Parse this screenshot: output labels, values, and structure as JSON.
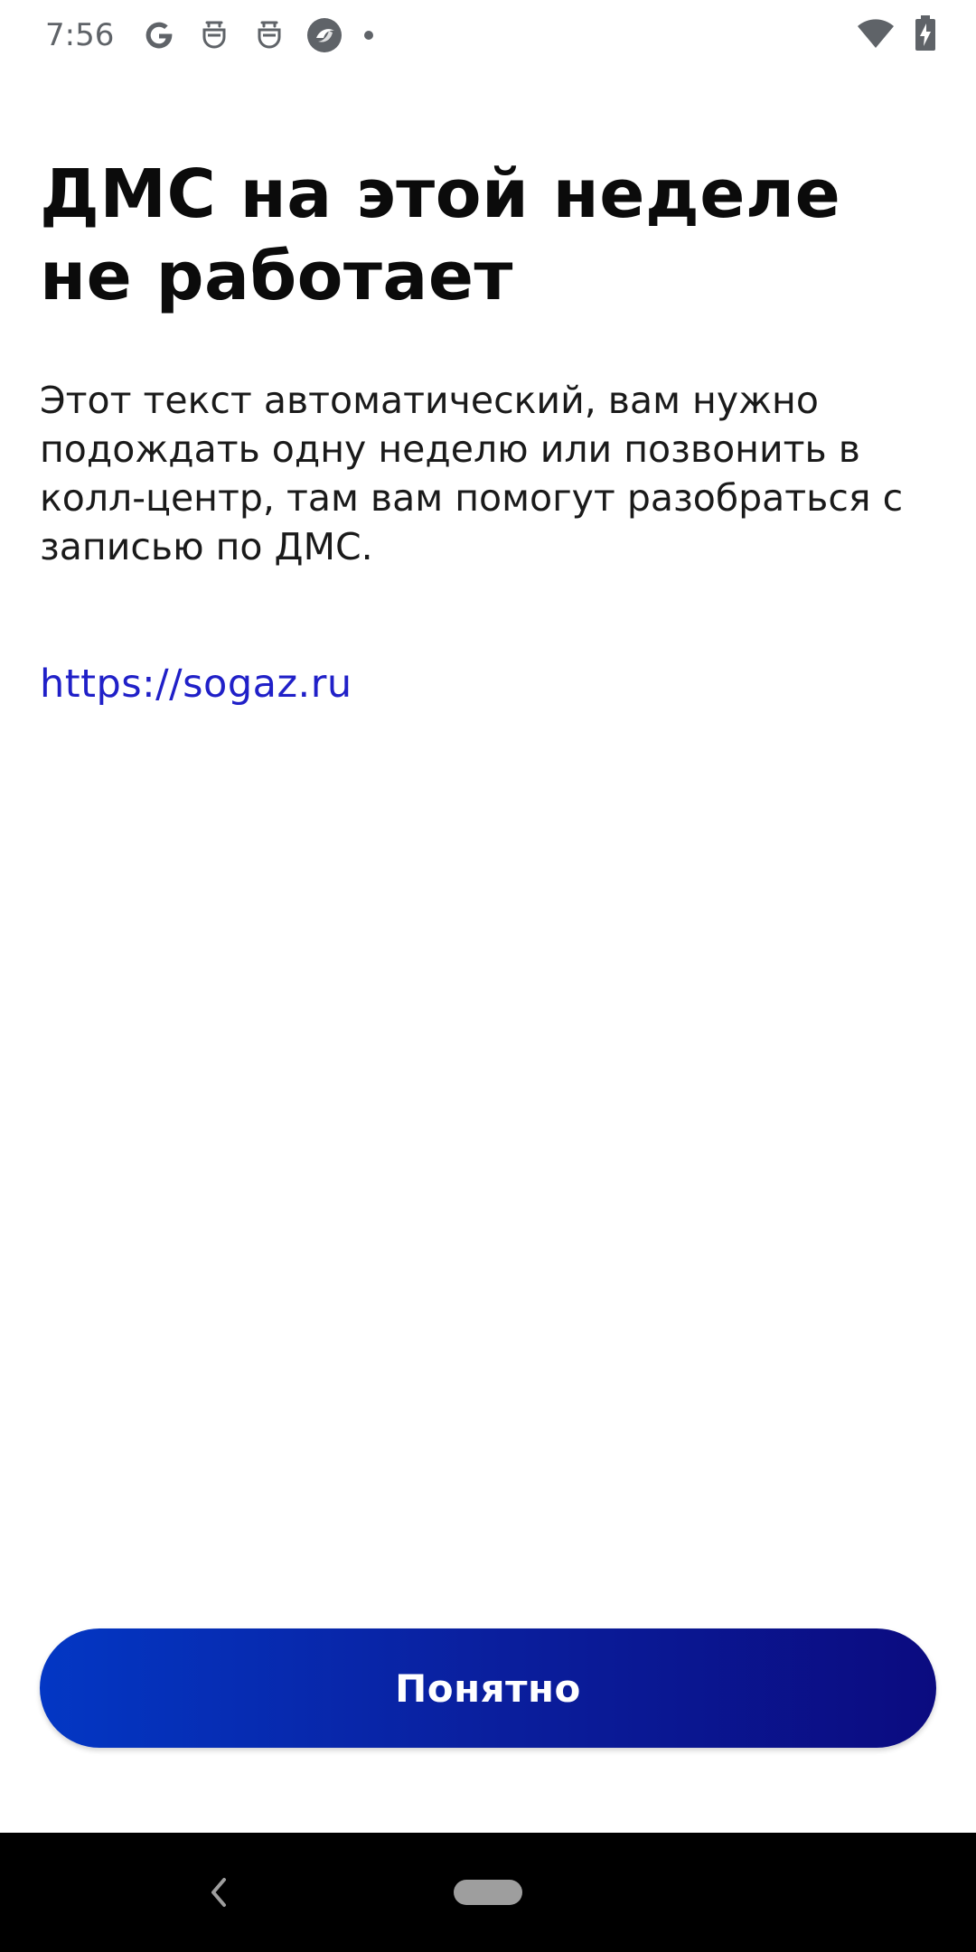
{
  "status_bar": {
    "time": "7:56",
    "notification_icons": [
      "google-icon",
      "robot-icon",
      "robot-icon",
      "browser-icon",
      "dot-icon"
    ],
    "system_icons": [
      "wifi-icon",
      "battery-charging-icon"
    ]
  },
  "dialog": {
    "title": "ДМС на этой неделе не работает",
    "message": "Этот текст автоматический, вам нужно подождать одну неделю или позвонить в колл-центр, там вам помогут разобраться с записью по ДМС.",
    "link": "https://sogaz.ru"
  },
  "actions": {
    "ok_label": "Понятно"
  },
  "nav_bar": {
    "icons": [
      "back-icon",
      "home-pill-icon"
    ]
  },
  "colors": {
    "link": "#2020c8",
    "button_gradient_start": "#0337c4",
    "button_gradient_end": "#0b0b80"
  }
}
